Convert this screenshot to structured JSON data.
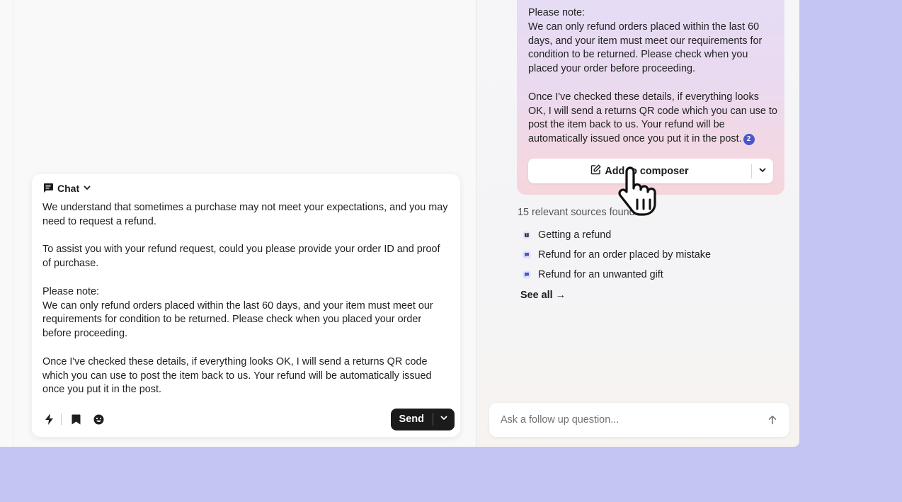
{
  "composer": {
    "channel_label": "Chat",
    "message": [
      "We understand that sometimes a purchase may not meet your expectations, and you may need to request a refund.",
      "To assist you with your refund request, could you please provide your order ID and proof of purchase.",
      "Please note:\nWe can only refund orders placed within the last 60 days, and your item must meet our requirements for condition to be returned. Please check when you placed your order before proceeding.",
      "Once I've checked these details, if everything looks OK, I will send a returns QR code which you can use to post the item back to us. Your refund will be automatically issued once you put it in the post."
    ],
    "toolbar_icons": [
      "lightning-icon",
      "bookmark-icon",
      "emoji-icon"
    ],
    "send_label": "Send"
  },
  "copilot": {
    "answer": {
      "note_heading": "Please note:",
      "note_body": "We can only refund orders placed within the last 60 days, and your item must meet our requirements for condition to be returned. Please check when you placed your order before proceeding.",
      "closing": "Once I've checked these details, if everything looks OK, I will send a returns QR code which you can use to post the item back to us. Your refund will be automatically issued once you put it in the post.",
      "citation": "2"
    },
    "add_to_composer_label": "Add to composer",
    "sources_count_text": "15 relevant sources found",
    "sources": [
      {
        "label": "Getting a refund",
        "icon": "article-icon"
      },
      {
        "label": "Refund for an order placed by mistake",
        "icon": "conversation-icon"
      },
      {
        "label": "Refund for an unwanted gift",
        "icon": "conversation-icon"
      }
    ],
    "see_all_label": "See all →",
    "followup_placeholder": "Ask a follow up question..."
  },
  "colors": {
    "background": "#c5c5f3",
    "send_button": "#1b1b1b",
    "citation_badge": "#4b57c9",
    "source_icon": "#4b57c9"
  }
}
